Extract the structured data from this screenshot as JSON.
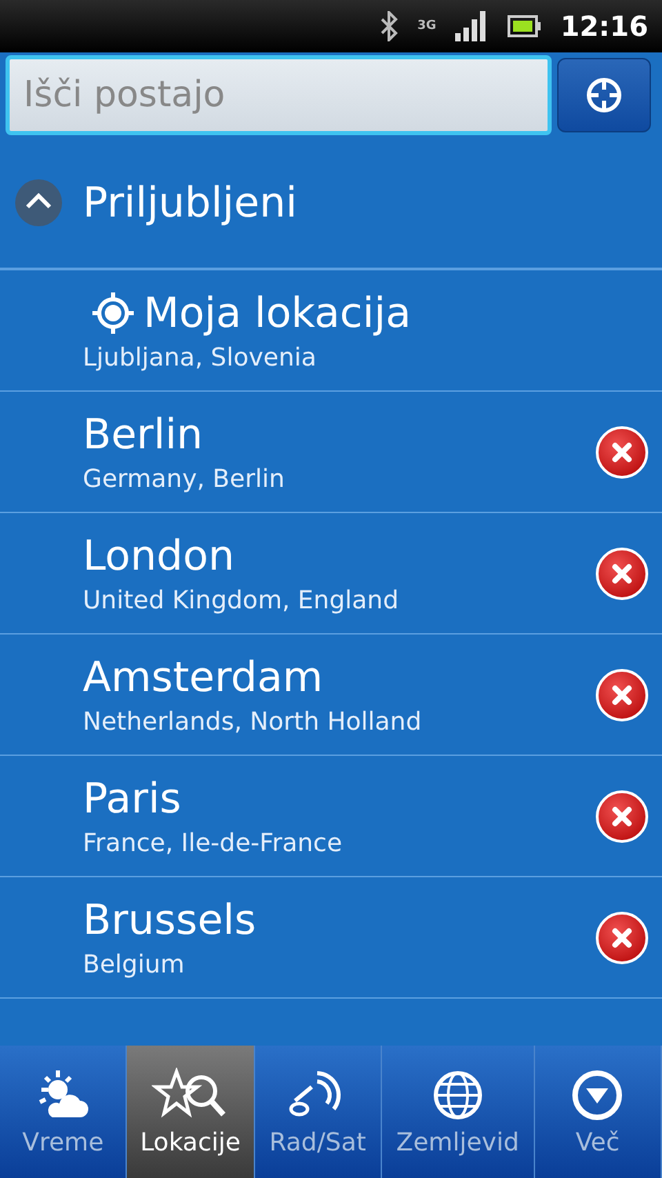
{
  "status_bar": {
    "time": "12:16",
    "network": "3G"
  },
  "search": {
    "placeholder": "Išči postajo"
  },
  "group": {
    "title": "Priljubljeni",
    "expanded": true
  },
  "locations": [
    {
      "kind": "current",
      "name": "Moja lokacija",
      "region": "Ljubljana, Slovenia",
      "removable": false
    },
    {
      "kind": "city",
      "name": "Berlin",
      "region": "Germany, Berlin",
      "removable": true
    },
    {
      "kind": "city",
      "name": "London",
      "region": "United Kingdom, England",
      "removable": true
    },
    {
      "kind": "city",
      "name": "Amsterdam",
      "region": "Netherlands, North Holland",
      "removable": true
    },
    {
      "kind": "city",
      "name": "Paris",
      "region": "France, Ile-de-France",
      "removable": true
    },
    {
      "kind": "city",
      "name": "Brussels",
      "region": "Belgium",
      "removable": true
    }
  ],
  "tabs": [
    {
      "kind": "weather",
      "label": "Vreme",
      "selected": false
    },
    {
      "kind": "locations",
      "label": "Lokacije",
      "selected": true
    },
    {
      "kind": "radar",
      "label": "Rad/Sat",
      "selected": false
    },
    {
      "kind": "globe",
      "label": "Zemljevid",
      "selected": false
    },
    {
      "kind": "more",
      "label": "Več",
      "selected": false
    }
  ]
}
